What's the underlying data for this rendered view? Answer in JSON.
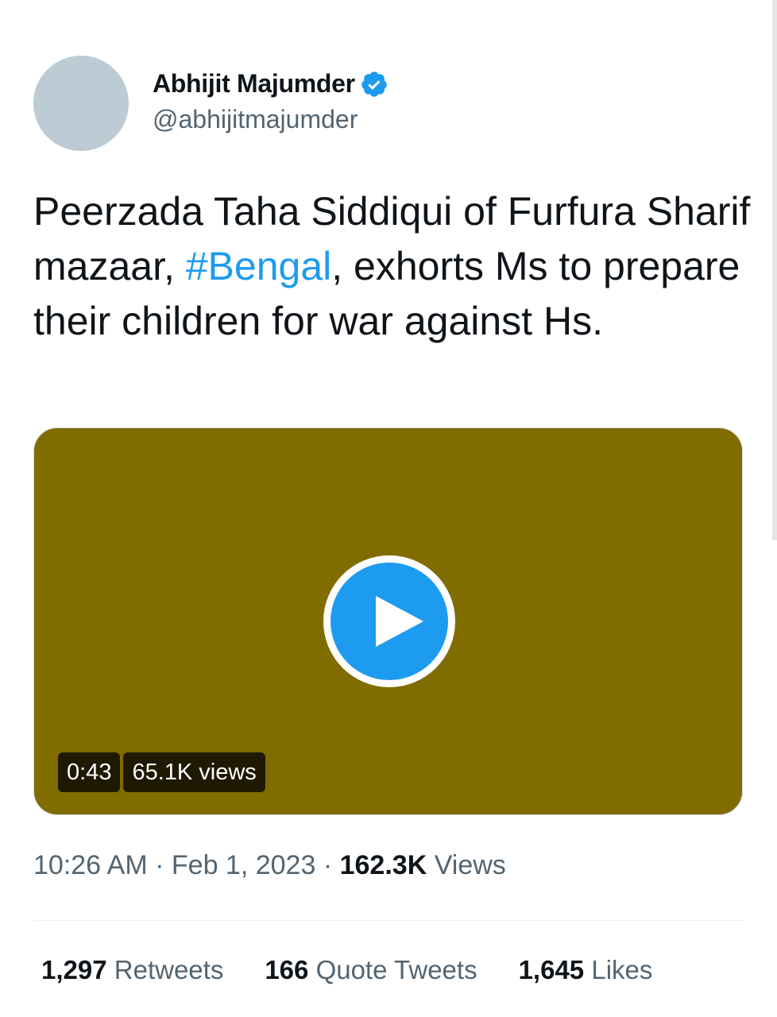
{
  "author": {
    "display_name": "Abhijit Majumder",
    "handle": "@abhijitmajumder",
    "verified": true,
    "verified_icon": "verified-badge-icon",
    "avatar_color": "#bccbd4"
  },
  "tweet": {
    "text_part1": "Peerzada Taha Siddiqui of Furfura Sharif mazaar, ",
    "hashtag": "#Bengal",
    "text_part2": ", exhorts Ms to prepare their children for war against Hs."
  },
  "media": {
    "background_color": "#806c00",
    "play_icon": "play-icon",
    "duration": "0:43",
    "views": "65.1K views"
  },
  "meta": {
    "time": "10:26 AM",
    "separator": "·",
    "date": "Feb 1, 2023",
    "views_count": "162.3K",
    "views_label": "Views"
  },
  "stats": {
    "retweets_count": "1,297",
    "retweets_label": "Retweets",
    "quotes_count": "166",
    "quotes_label": "Quote Tweets",
    "likes_count": "1,645",
    "likes_label": "Likes"
  },
  "colors": {
    "accent": "#1d9bf0",
    "secondary_text": "#536471",
    "primary_text": "#0f1419"
  }
}
